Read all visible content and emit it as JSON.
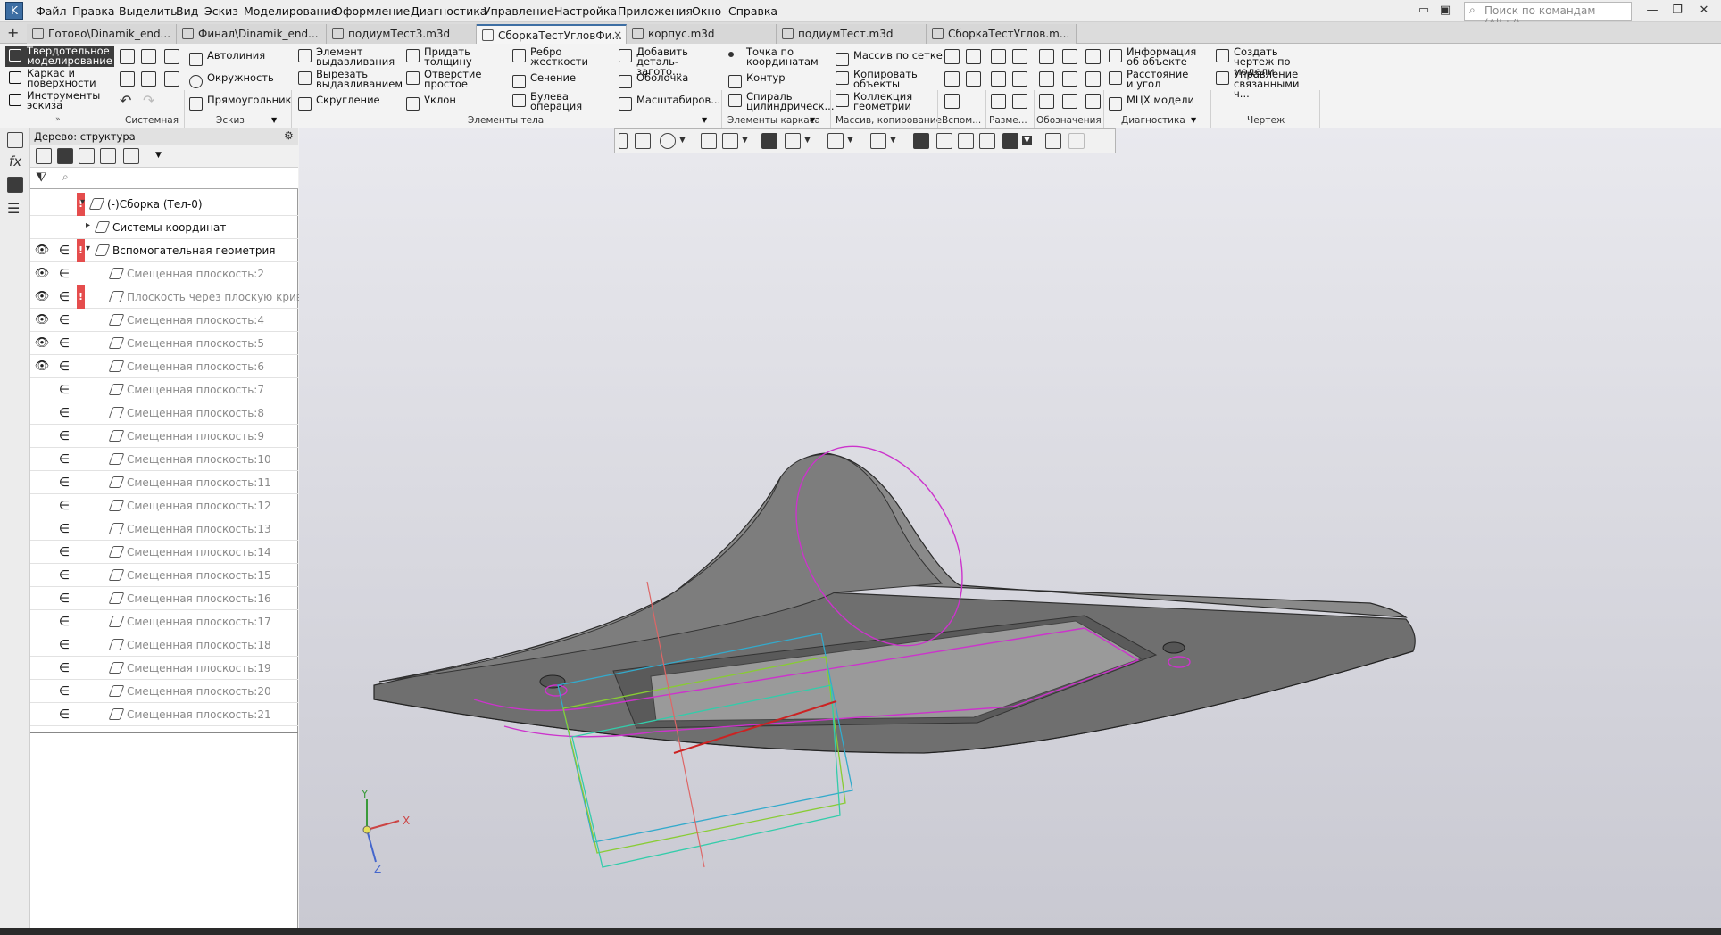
{
  "menubar": {
    "items": [
      "Файл",
      "Правка",
      "Выделить",
      "Вид",
      "Эскиз",
      "Моделирование",
      "Оформление",
      "Диагностика",
      "Управление",
      "Настройка",
      "Приложения",
      "Окно",
      "Справка"
    ],
    "search_placeholder": "Поиск по командам (Alt+/)"
  },
  "tabs": [
    {
      "label": "Готово\\Dinamik_end..."
    },
    {
      "label": "Финал\\Dinamik_end..."
    },
    {
      "label": "подиумТест3.m3d"
    },
    {
      "label": "СборкаТестУгловФи..."
    },
    {
      "label": "корпус.m3d"
    },
    {
      "label": "подиумТест.m3d"
    },
    {
      "label": "СборкаТестУглов.m..."
    }
  ],
  "ribbon": {
    "modes": [
      "Твердотельное моделирование",
      "Каркас и поверхности",
      "Инструменты эскиза"
    ],
    "groups": {
      "system": "Системная",
      "sketch": "Эскиз",
      "body": "Элементы тела",
      "frame": "Элементы каркаса",
      "array": "Массив, копирование",
      "aux": "Вспом...",
      "dims": "Разме...",
      "marks": "Обозначения",
      "diag": "Диагностика",
      "drawing": "Чертеж"
    },
    "sketch_buttons": [
      "Автолиния",
      "Окружность",
      "Прямоугольник"
    ],
    "body_buttons": [
      "Элемент выдавливания",
      "Вырезать выдавливанием",
      "Скругление",
      "Придать толщину",
      "Отверстие простое",
      "Уклон",
      "Ребро жесткости",
      "Сечение",
      "Булева операция",
      "Добавить деталь-загото...",
      "Оболочка",
      "Масштабиров..."
    ],
    "frame_buttons": [
      "Точка по координатам",
      "Контур",
      "Спираль цилиндрическ..."
    ],
    "array_buttons": [
      "Массив по сетке",
      "Копировать объекты",
      "Коллекция геометрии"
    ],
    "diag_buttons": [
      "Информация об объекте",
      "Расстояние и угол",
      "МЦХ модели"
    ],
    "drawing_buttons": [
      "Создать чертеж по модели",
      "Управление связанными ч..."
    ]
  },
  "tree": {
    "title": "Дерево: структура",
    "rows": [
      {
        "label": "(-)Сборка (Тел-0)",
        "dim": false
      },
      {
        "label": "Системы координат",
        "dim": false
      },
      {
        "label": "Вспомогательная геометрия",
        "dim": false
      },
      {
        "label": "Смещенная плоскость:2",
        "dim": true
      },
      {
        "label": "Плоскость через плоскую кривую",
        "dim": true
      },
      {
        "label": "Смещенная плоскость:4",
        "dim": true
      },
      {
        "label": "Смещенная плоскость:5",
        "dim": true
      },
      {
        "label": "Смещенная плоскость:6",
        "dim": true
      },
      {
        "label": "Смещенная плоскость:7",
        "dim": true
      },
      {
        "label": "Смещенная плоскость:8",
        "dim": true
      },
      {
        "label": "Смещенная плоскость:9",
        "dim": true
      },
      {
        "label": "Смещенная плоскость:10",
        "dim": true
      },
      {
        "label": "Смещенная плоскость:11",
        "dim": true
      },
      {
        "label": "Смещенная плоскость:12",
        "dim": true
      },
      {
        "label": "Смещенная плоскость:13",
        "dim": true
      },
      {
        "label": "Смещенная плоскость:14",
        "dim": true
      },
      {
        "label": "Смещенная плоскость:15",
        "dim": true
      },
      {
        "label": "Смещенная плоскость:16",
        "dim": true
      },
      {
        "label": "Смещенная плоскость:17",
        "dim": true
      },
      {
        "label": "Смещенная плоскость:18",
        "dim": true
      },
      {
        "label": "Смещенная плоскость:19",
        "dim": true
      },
      {
        "label": "Смещенная плоскость:20",
        "dim": true
      },
      {
        "label": "Смещенная плоскость:21",
        "dim": true
      }
    ]
  },
  "axes": {
    "x": "X",
    "y": "Y",
    "z": "Z"
  },
  "colors": {
    "accent": "#3d6ea3",
    "error": "#e54d4d",
    "sketch": "#cc33cc"
  },
  "symbols": {
    "eye": "👁",
    "include": "∈",
    "error": "!",
    "close": "×",
    "filter": "▼",
    "search": "⌕",
    "plus": "+"
  }
}
